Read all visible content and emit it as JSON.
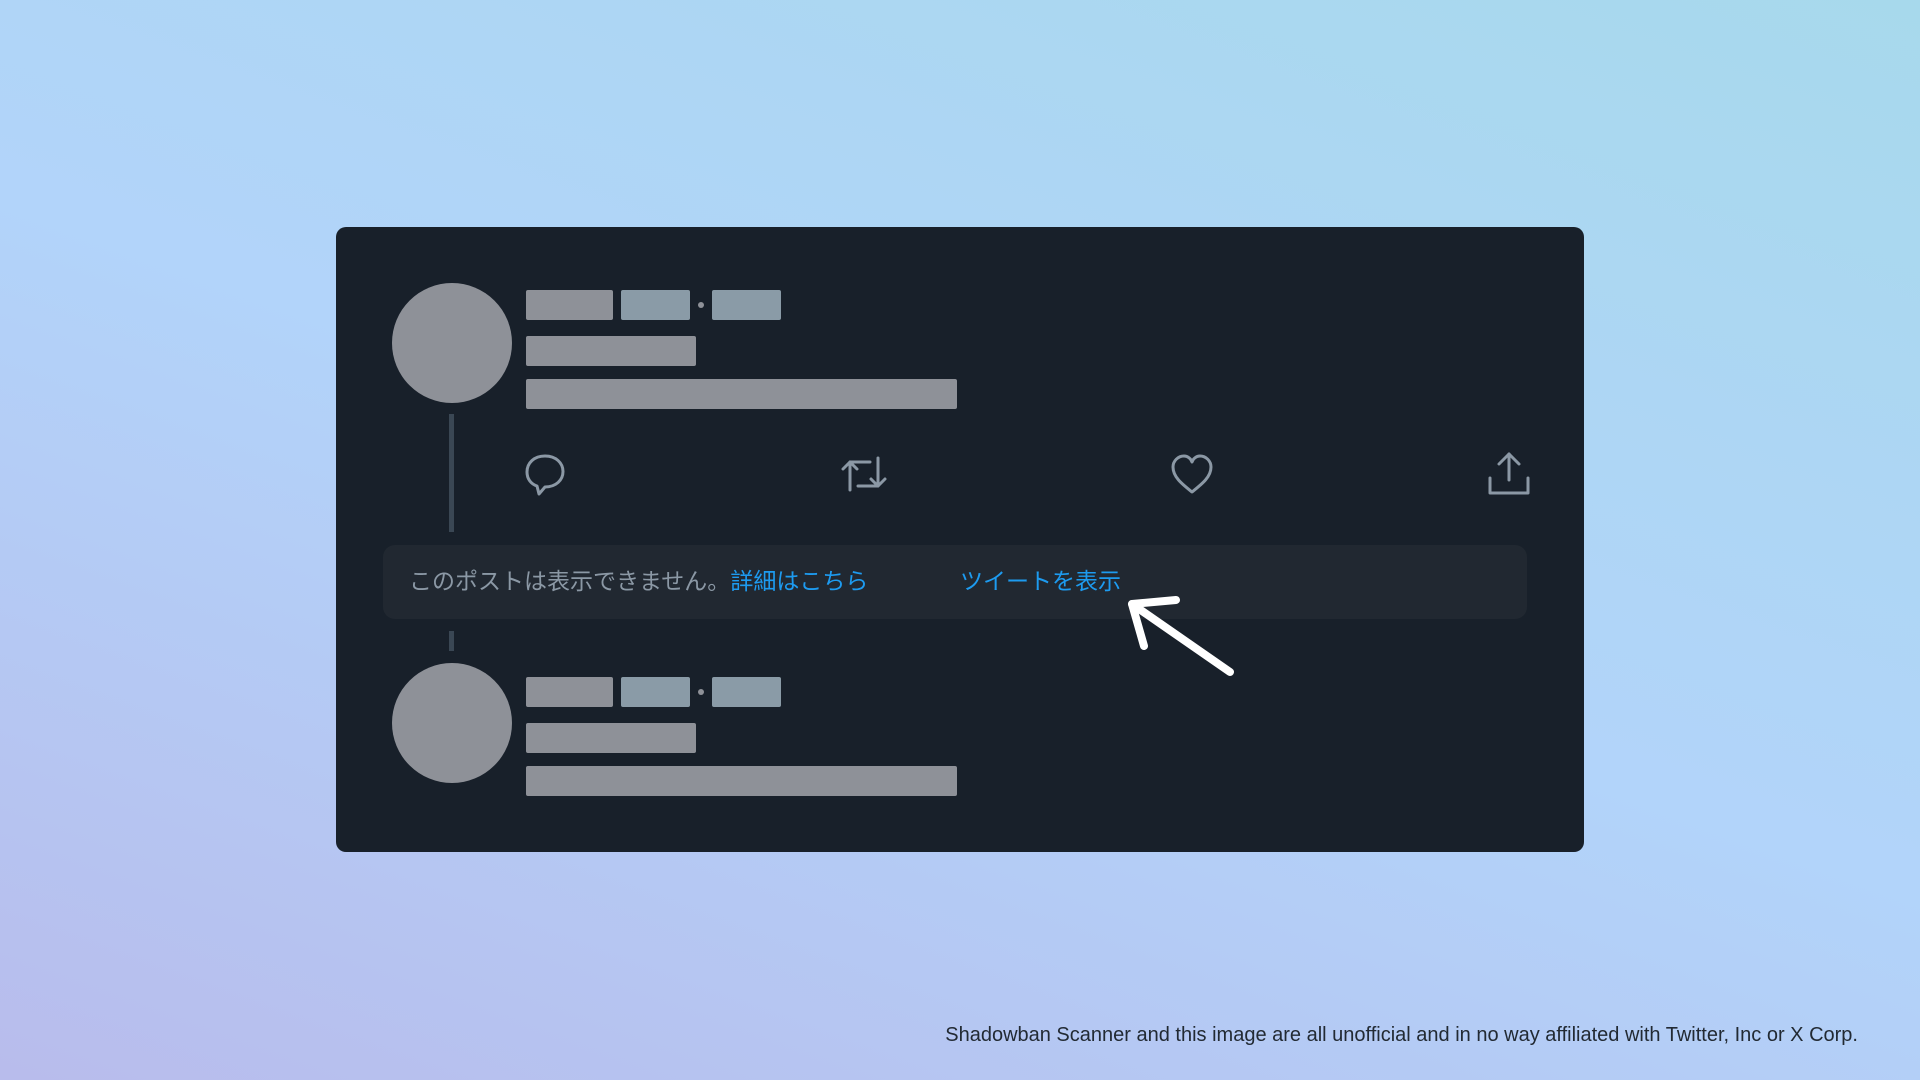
{
  "colors": {
    "card_bg": "#18202a",
    "notice_bg": "#212831",
    "placeholder_gray": "#8e9198",
    "placeholder_blue": "#8a9ba7",
    "link_blue": "#1d9bf0",
    "icon_gray": "#8b98a5"
  },
  "tweet_actions": {
    "reply_icon": "speech-bubble",
    "retweet_icon": "retweet-arrows",
    "like_icon": "heart",
    "share_icon": "upload-arrow"
  },
  "notice": {
    "message": "このポストは表示できません。",
    "learn_more": "詳細はこちら",
    "show_tweet": "ツイートを表示"
  },
  "footer": {
    "disclaimer": "Shadowban Scanner and this image are all unofficial and in no way affiliated with Twitter, Inc or X Corp."
  }
}
